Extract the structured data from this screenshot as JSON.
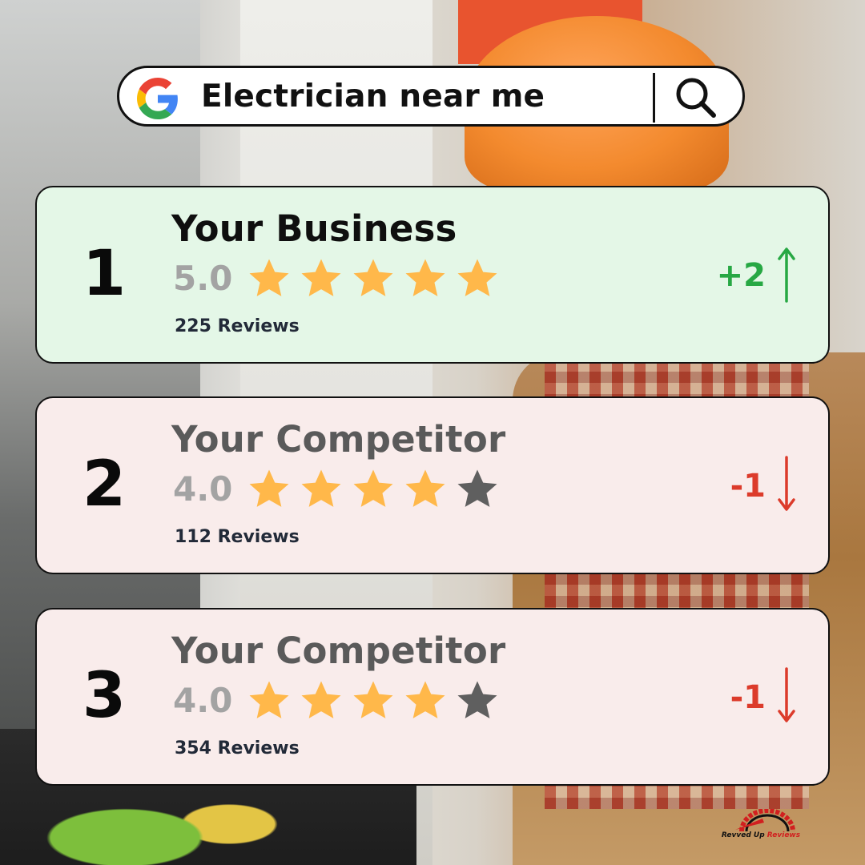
{
  "colors": {
    "winner_card_bg": "#e4f7e7",
    "competitor_card_bg": "#f9eceb",
    "star_filled": "#ffb84a",
    "star_empty": "#5f5f5f",
    "up": "#27a844",
    "down": "#dc3b2b"
  },
  "search": {
    "query": "Electrician near me",
    "logo_icon": "google-g-icon",
    "button_icon": "search-icon"
  },
  "results": [
    {
      "rank": "1",
      "name": "Your Business",
      "rating": "5.0",
      "stars_filled": 5,
      "stars_total": 5,
      "reviews": "225 Reviews",
      "change": "+2",
      "direction": "up",
      "arrow_icon": "arrow-up-icon"
    },
    {
      "rank": "2",
      "name": "Your Competitor",
      "rating": "4.0",
      "stars_filled": 4,
      "stars_total": 5,
      "reviews": "112 Reviews",
      "change": "-1",
      "direction": "down",
      "arrow_icon": "arrow-down-icon"
    },
    {
      "rank": "3",
      "name": "Your Competitor",
      "rating": "4.0",
      "stars_filled": 4,
      "stars_total": 5,
      "reviews": "354 Reviews",
      "change": "-1",
      "direction": "down",
      "arrow_icon": "arrow-down-icon"
    }
  ],
  "brand": {
    "logo_part1": "Revved Up ",
    "logo_part2": "Reviews"
  }
}
